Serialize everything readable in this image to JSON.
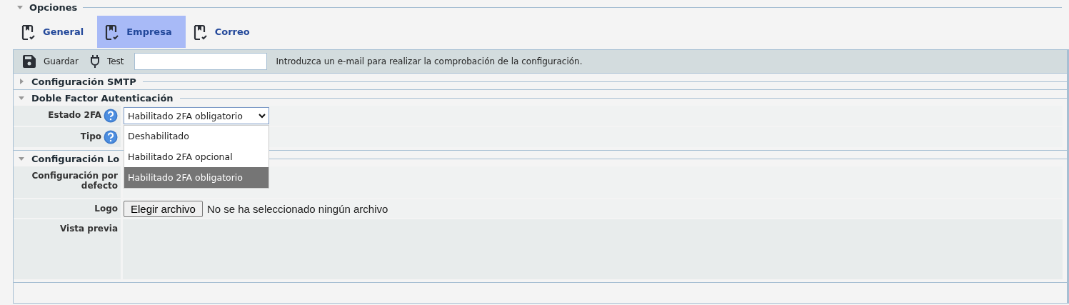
{
  "section": {
    "title": "Opciones",
    "expanded": true
  },
  "tabs": [
    {
      "label": "General",
      "selected": false
    },
    {
      "label": "Empresa",
      "selected": true
    },
    {
      "label": "Correo",
      "selected": false
    }
  ],
  "toolbar": {
    "save_label": "Guardar",
    "test_label": "Test",
    "hint": "Introduzca un e-mail para realizar la comprobación de la configuración."
  },
  "groups": [
    {
      "title": "Configuración SMTP",
      "expanded": false
    },
    {
      "title": "Doble Factor Autenticación",
      "expanded": true,
      "rows": [
        {
          "label": "Estado 2FA",
          "help": true,
          "kind": "select",
          "value": "Habilitado 2FA obligatorio",
          "open": true,
          "options": [
            {
              "label": "Deshabilitado",
              "selected": false
            },
            {
              "label": "Habilitado 2FA opcional",
              "selected": false
            },
            {
              "label": "Habilitado 2FA obligatorio",
              "selected": true
            }
          ]
        },
        {
          "label": "Tipo",
          "help": true,
          "kind": "covered"
        }
      ]
    },
    {
      "title": "Configuración Lo",
      "expanded": true,
      "rows": [
        {
          "label": "Configuración por defecto",
          "help": false,
          "kind": "covered"
        },
        {
          "label": "Logo",
          "help": false,
          "kind": "file",
          "button": "Elegir archivo",
          "status": "No se ha seleccionado ningún archivo"
        },
        {
          "label": "Vista previa",
          "help": false,
          "kind": "preview"
        }
      ]
    }
  ]
}
